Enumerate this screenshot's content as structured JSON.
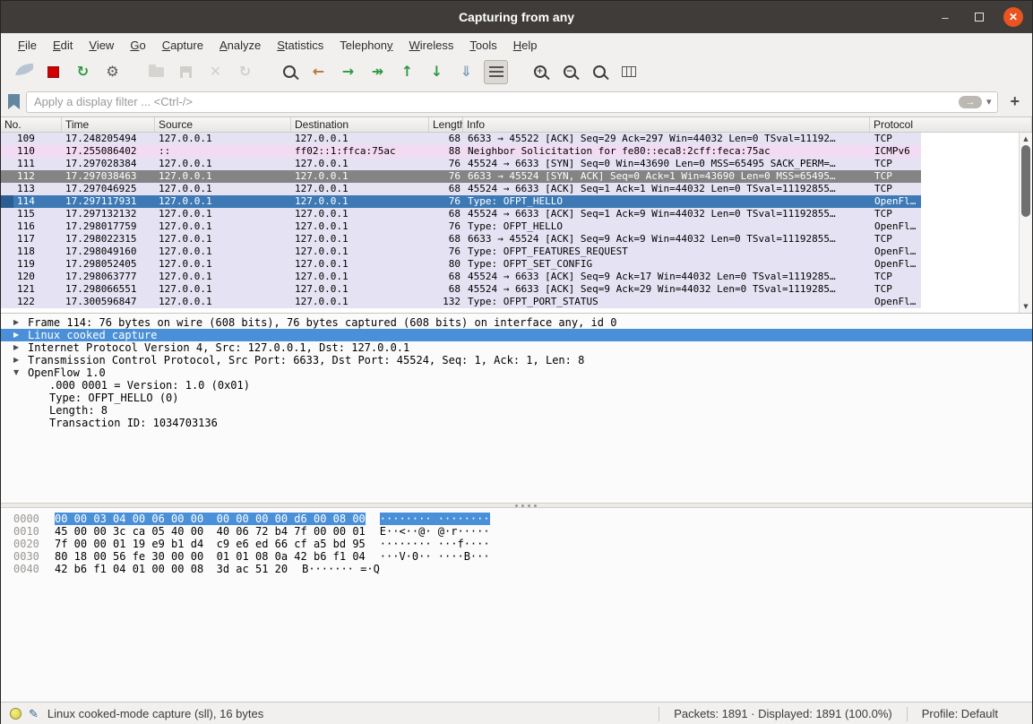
{
  "window": {
    "title": "Capturing from any",
    "minimize_glyph": "–",
    "close_glyph": "✕"
  },
  "colors": {
    "row_tcp": "#e5e3f3",
    "row_icmpv6": "#f3dcf3",
    "row_syn": "#848484",
    "row_selected": "#3c79b5",
    "detail_selected": "#4a90d9",
    "close_button": "#e95420",
    "titlebar": "#3f3c3a"
  },
  "menu": {
    "items": [
      {
        "label": "File",
        "underline": 0
      },
      {
        "label": "Edit",
        "underline": 0
      },
      {
        "label": "View",
        "underline": 0
      },
      {
        "label": "Go",
        "underline": 0
      },
      {
        "label": "Capture",
        "underline": 0
      },
      {
        "label": "Analyze",
        "underline": 0
      },
      {
        "label": "Statistics",
        "underline": 0
      },
      {
        "label": "Telephony",
        "underline": 8
      },
      {
        "label": "Wireless",
        "underline": 0
      },
      {
        "label": "Tools",
        "underline": 0
      },
      {
        "label": "Help",
        "underline": 0
      }
    ]
  },
  "toolbar": {
    "buttons": [
      {
        "name": "start-capture",
        "kind": "fin",
        "color": "#7d9cb5",
        "enabled": false
      },
      {
        "name": "stop-capture",
        "kind": "stop",
        "color": "#d40000",
        "enabled": true
      },
      {
        "name": "restart-capture",
        "kind": "glyph",
        "glyph": "↻",
        "color": "#2d9a41",
        "enabled": true
      },
      {
        "name": "capture-options",
        "kind": "glyph",
        "glyph": "⚙",
        "color": "#5a5a5a",
        "enabled": true
      },
      {
        "name": "open-file",
        "kind": "folder",
        "enabled": false,
        "gap": true
      },
      {
        "name": "save-file",
        "kind": "save",
        "enabled": false
      },
      {
        "name": "close-file",
        "kind": "glyph",
        "glyph": "✕",
        "color": "#b3afaa",
        "enabled": false
      },
      {
        "name": "reload-file",
        "kind": "glyph",
        "glyph": "↻",
        "color": "#b3afaa",
        "enabled": false
      },
      {
        "name": "find-packet",
        "kind": "mag",
        "sub": "",
        "enabled": true,
        "gap": true
      },
      {
        "name": "go-back",
        "kind": "glyph",
        "glyph": "←",
        "color": "#b5782d",
        "enabled": true
      },
      {
        "name": "go-forward",
        "kind": "glyph",
        "glyph": "→",
        "color": "#2d9a41",
        "enabled": true
      },
      {
        "name": "go-to-packet",
        "kind": "glyph",
        "glyph": "↠",
        "color": "#2d9a41",
        "enabled": true
      },
      {
        "name": "go-first-packet",
        "kind": "glyph",
        "glyph": "↑",
        "color": "#2d9a41",
        "enabled": true
      },
      {
        "name": "go-last-packet",
        "kind": "glyph",
        "glyph": "↓",
        "color": "#2d9a41",
        "enabled": true
      },
      {
        "name": "scroll-to-bottom",
        "kind": "glyph",
        "glyph": "⇓",
        "color": "#7d9cb5",
        "enabled": true
      },
      {
        "name": "auto-scroll",
        "kind": "lines",
        "enabled": true,
        "pressed": true
      },
      {
        "name": "zoom-in",
        "kind": "mag",
        "sub": "+",
        "enabled": true,
        "gap": true
      },
      {
        "name": "zoom-out",
        "kind": "mag",
        "sub": "−",
        "enabled": true
      },
      {
        "name": "zoom-original",
        "kind": "mag",
        "sub": "",
        "enabled": true
      },
      {
        "name": "resize-columns",
        "kind": "cols",
        "enabled": true
      }
    ]
  },
  "filter": {
    "placeholder": "Apply a display filter ... <Ctrl-/>",
    "apply_glyph": "→",
    "caret_glyph": "▾",
    "add_label": "+"
  },
  "packet_list": {
    "columns": [
      {
        "key": "no",
        "label": "No."
      },
      {
        "key": "time",
        "label": "Time"
      },
      {
        "key": "source",
        "label": "Source"
      },
      {
        "key": "destination",
        "label": "Destination"
      },
      {
        "key": "length",
        "label": "Length"
      },
      {
        "key": "info",
        "label": "Info"
      },
      {
        "key": "protocol",
        "label": "Protocol"
      }
    ],
    "scrollbar": {
      "up": "▲",
      "down": "▼"
    },
    "rows": [
      {
        "no": "109",
        "time": "17.248205494",
        "source": "127.0.0.1",
        "destination": "127.0.0.1",
        "length": "68",
        "info": "6633 → 45522 [ACK] Seq=29 Ack=297 Win=44032 Len=0 TSval=11192…",
        "protocol": "TCP",
        "style": "tcp"
      },
      {
        "no": "110",
        "time": "17.255086402",
        "source": "::",
        "destination": "ff02::1:ffca:75ac",
        "length": "88",
        "info": "Neighbor Solicitation for fe80::eca8:2cff:feca:75ac",
        "protocol": "ICMPv6",
        "style": "icmpv6"
      },
      {
        "no": "111",
        "time": "17.297028384",
        "source": "127.0.0.1",
        "destination": "127.0.0.1",
        "length": "76",
        "info": "45524 → 6633 [SYN] Seq=0 Win=43690 Len=0 MSS=65495 SACK_PERM=…",
        "protocol": "TCP",
        "style": "tcp"
      },
      {
        "no": "112",
        "time": "17.297038463",
        "source": "127.0.0.1",
        "destination": "127.0.0.1",
        "length": "76",
        "info": "6633 → 45524 [SYN, ACK] Seq=0 Ack=1 Win=43690 Len=0 MSS=65495…",
        "protocol": "TCP",
        "style": "syn"
      },
      {
        "no": "113",
        "time": "17.297046925",
        "source": "127.0.0.1",
        "destination": "127.0.0.1",
        "length": "68",
        "info": "45524 → 6633 [ACK] Seq=1 Ack=1 Win=44032 Len=0 TSval=11192855…",
        "protocol": "TCP",
        "style": "tcp"
      },
      {
        "no": "114",
        "time": "17.297117931",
        "source": "127.0.0.1",
        "destination": "127.0.0.1",
        "length": "76",
        "info": "Type: OFPT_HELLO",
        "protocol": "OpenFl…",
        "style": "selected"
      },
      {
        "no": "115",
        "time": "17.297132132",
        "source": "127.0.0.1",
        "destination": "127.0.0.1",
        "length": "68",
        "info": "45524 → 6633 [ACK] Seq=1 Ack=9 Win=44032 Len=0 TSval=11192855…",
        "protocol": "TCP",
        "style": "tcp"
      },
      {
        "no": "116",
        "time": "17.298017759",
        "source": "127.0.0.1",
        "destination": "127.0.0.1",
        "length": "76",
        "info": "Type: OFPT_HELLO",
        "protocol": "OpenFl…",
        "style": "tcp"
      },
      {
        "no": "117",
        "time": "17.298022315",
        "source": "127.0.0.1",
        "destination": "127.0.0.1",
        "length": "68",
        "info": "6633 → 45524 [ACK] Seq=9 Ack=9 Win=44032 Len=0 TSval=11192855…",
        "protocol": "TCP",
        "style": "tcp"
      },
      {
        "no": "118",
        "time": "17.298049160",
        "source": "127.0.0.1",
        "destination": "127.0.0.1",
        "length": "76",
        "info": "Type: OFPT_FEATURES_REQUEST",
        "protocol": "OpenFl…",
        "style": "tcp"
      },
      {
        "no": "119",
        "time": "17.298052405",
        "source": "127.0.0.1",
        "destination": "127.0.0.1",
        "length": "80",
        "info": "Type: OFPT_SET_CONFIG",
        "protocol": "OpenFl…",
        "style": "tcp"
      },
      {
        "no": "120",
        "time": "17.298063777",
        "source": "127.0.0.1",
        "destination": "127.0.0.1",
        "length": "68",
        "info": "45524 → 6633 [ACK] Seq=9 Ack=17 Win=44032 Len=0 TSval=1119285…",
        "protocol": "TCP",
        "style": "tcp"
      },
      {
        "no": "121",
        "time": "17.298066551",
        "source": "127.0.0.1",
        "destination": "127.0.0.1",
        "length": "68",
        "info": "45524 → 6633 [ACK] Seq=9 Ack=29 Win=44032 Len=0 TSval=1119285…",
        "protocol": "TCP",
        "style": "tcp"
      },
      {
        "no": "122",
        "time": "17.300596847",
        "source": "127.0.0.1",
        "destination": "127.0.0.1",
        "length": "132",
        "info": "Type: OFPT_PORT_STATUS",
        "protocol": "OpenFl…",
        "style": "tcp"
      }
    ]
  },
  "details": {
    "rows": [
      {
        "arrow": "▶",
        "indent": 0,
        "selected": false,
        "text": "Frame 114: 76 bytes on wire (608 bits), 76 bytes captured (608 bits) on interface any, id 0"
      },
      {
        "arrow": "▶",
        "indent": 0,
        "selected": true,
        "text": "Linux cooked capture"
      },
      {
        "arrow": "▶",
        "indent": 0,
        "selected": false,
        "text": "Internet Protocol Version 4, Src: 127.0.0.1, Dst: 127.0.0.1"
      },
      {
        "arrow": "▶",
        "indent": 0,
        "selected": false,
        "text": "Transmission Control Protocol, Src Port: 6633, Dst Port: 45524, Seq: 1, Ack: 1, Len: 8"
      },
      {
        "arrow": "▼",
        "indent": 0,
        "selected": false,
        "text": "OpenFlow 1.0"
      },
      {
        "arrow": "",
        "indent": 1,
        "selected": false,
        "text": ".000 0001 = Version: 1.0 (0x01)"
      },
      {
        "arrow": "",
        "indent": 1,
        "selected": false,
        "text": "Type: OFPT_HELLO (0)"
      },
      {
        "arrow": "",
        "indent": 1,
        "selected": false,
        "text": "Length: 8"
      },
      {
        "arrow": "",
        "indent": 1,
        "selected": false,
        "text": "Transaction ID: 1034703136"
      }
    ]
  },
  "hex": {
    "rows": [
      {
        "offset": "0000",
        "hex": "00 00 03 04 00 06 00 00  00 00 00 00 d6 00 08 00",
        "ascii": "········ ········",
        "highlighted": true
      },
      {
        "offset": "0010",
        "hex": "45 00 00 3c ca 05 40 00  40 06 72 b4 7f 00 00 01",
        "ascii": "E··<··@· @·r·····",
        "highlighted": false
      },
      {
        "offset": "0020",
        "hex": "7f 00 00 01 19 e9 b1 d4  c9 e6 ed 66 cf a5 bd 95",
        "ascii": "········ ···f····",
        "highlighted": false
      },
      {
        "offset": "0030",
        "hex": "80 18 00 56 fe 30 00 00  01 01 08 0a 42 b6 f1 04",
        "ascii": "···V·0·· ····B···",
        "highlighted": false
      },
      {
        "offset": "0040",
        "hex": "42 b6 f1 04 01 00 00 08  3d ac 51 20",
        "ascii": "B······· =·Q ",
        "highlighted": false
      }
    ]
  },
  "status": {
    "capture_info": "Linux cooked-mode capture (sll), 16 bytes",
    "packets": "Packets: 1891 · Displayed: 1891 (100.0%)",
    "profile": "Profile: Default"
  }
}
